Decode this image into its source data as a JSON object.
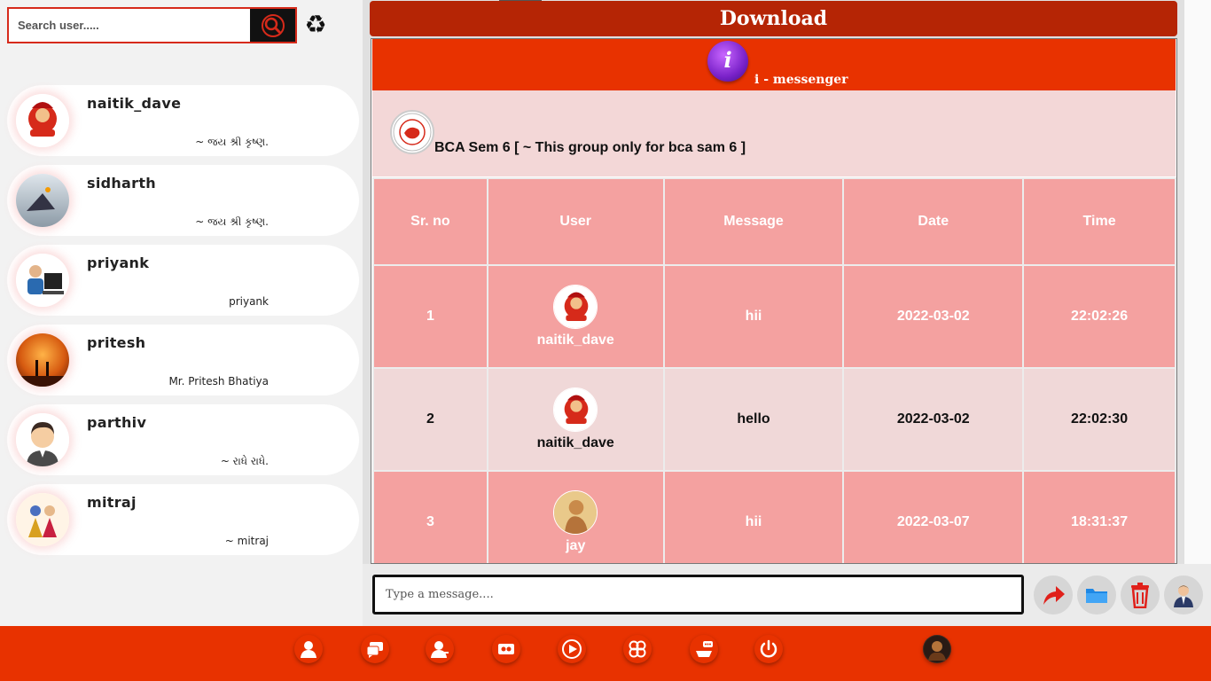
{
  "search": {
    "placeholder": "Search user....."
  },
  "contacts": [
    {
      "name": "naitik_dave",
      "status": "~ જય શ્રી કૃષ્ણ."
    },
    {
      "name": "sidharth",
      "status": "~ જય શ્રી કૃષ્ણ."
    },
    {
      "name": "priyank",
      "status": "priyank"
    },
    {
      "name": "pritesh",
      "status": "Mr. Pritesh Bhatiya"
    },
    {
      "name": "parthiv",
      "status": "~ રાધે રાધે."
    },
    {
      "name": "mitraj",
      "status": "~ mitraj"
    }
  ],
  "header": {
    "download_label": "Download"
  },
  "app": {
    "logo_letter": "i",
    "name": "i - messenger"
  },
  "group": {
    "title": "BCA Sem 6 [ ~ This group only for bca sam 6 ]"
  },
  "table": {
    "headers": [
      "Sr. no",
      "User",
      "Message",
      "Date",
      "Time"
    ],
    "rows": [
      {
        "sr": "1",
        "user": "naitik_dave",
        "message": "hii",
        "date": "2022-03-02",
        "time": "22:02:26"
      },
      {
        "sr": "2",
        "user": "naitik_dave",
        "message": "hello",
        "date": "2022-03-02",
        "time": "22:02:30"
      },
      {
        "sr": "3",
        "user": "jay",
        "message": "hii",
        "date": "2022-03-07",
        "time": "18:31:37"
      }
    ]
  },
  "composer": {
    "placeholder": "Type a message...."
  },
  "colors": {
    "brand_red": "#e83200",
    "download_red": "#b52505",
    "row_pink": "#f4a1a0",
    "row_light": "#f0d8d8"
  }
}
